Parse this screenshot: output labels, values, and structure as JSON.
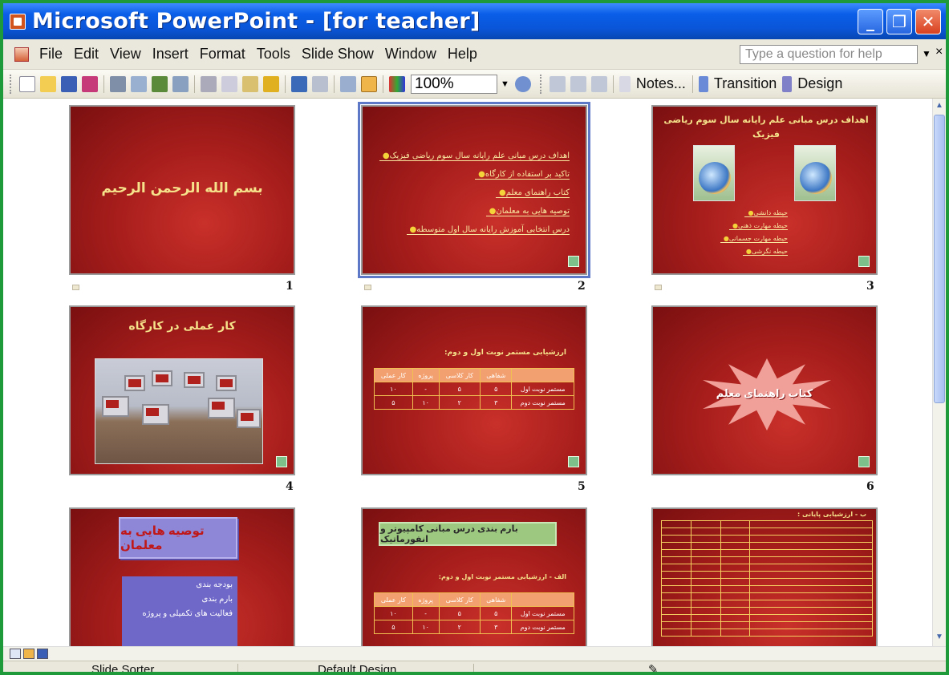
{
  "window": {
    "title": "Microsoft PowerPoint - [for teacher]",
    "min": "_",
    "restore": "❐",
    "close": "✕"
  },
  "menu": {
    "items": [
      "File",
      "Edit",
      "View",
      "Insert",
      "Format",
      "Tools",
      "Slide Show",
      "Window",
      "Help"
    ],
    "help_placeholder": "Type a question for help",
    "help_close": "×"
  },
  "toolbar": {
    "zoom": "100%",
    "notes_label": "Notes...",
    "transition_label": "Transition",
    "design_label": "Design"
  },
  "slides": [
    {
      "num": "1",
      "title": "بسم الله الرحمن الرحیم"
    },
    {
      "num": "2",
      "bullets": [
        "اهداف درس مبانی علم رایانه سال سوم ریاضی فیزیک",
        "تاکید بر استفاده از کارگاه",
        "کتاب راهنمای معلم",
        "توصیه هایی به معلمان",
        "درس انتخابی آموزش رایانه سال اول متوسطه"
      ]
    },
    {
      "num": "3",
      "title": "اهداف درس مبانی علم رایانه سال سوم ریاضی فیزیک",
      "bullets": [
        "حیطه دانشی",
        "حیطه مهارت ذهنی",
        "حیطه مهارت جسمانی",
        "حیطه نگرشی"
      ]
    },
    {
      "num": "4",
      "title": "کار عملی در کارگاه"
    },
    {
      "num": "5",
      "title": "ارزشیابی مستمر نوبت اول و دوم:",
      "table": [
        [
          "کار عملی",
          "پروژه",
          "کار کلاسی",
          "شفاهی",
          ""
        ],
        [
          "۱۰",
          "-",
          "۵",
          "۵",
          "مستمر نوبت اول"
        ],
        [
          "۵",
          "۱۰",
          "۲",
          "۳",
          "مستمر نوبت دوم"
        ]
      ]
    },
    {
      "num": "6",
      "title": "کتاب راهنمای معلم"
    },
    {
      "num": "",
      "title": "توصیه هایی به معلمان",
      "bullets": [
        "بودجه بندی",
        "بارم بندی",
        "فعالیت های تکمیلی و پروژه"
      ]
    },
    {
      "num": "",
      "title": "بارم بندی درس مبانی کامپیوتر و انفورماتیک",
      "subtitle": "الف - ارزشیابی مستمر نوبت اول و دوم:",
      "table": [
        [
          "کار عملی",
          "پروژه",
          "کار کلاسی",
          "شفاهی",
          ""
        ],
        [
          "۱۰",
          "-",
          "۵",
          "۵",
          "مستمر نوبت اول"
        ],
        [
          "۵",
          "۱۰",
          "۲",
          "۳",
          "مستمر نوبت دوم"
        ]
      ]
    },
    {
      "num": "",
      "title": "ب - ارزشیابی پایانی :"
    }
  ],
  "status": {
    "view": "Slide Sorter",
    "design": "Default Design"
  }
}
